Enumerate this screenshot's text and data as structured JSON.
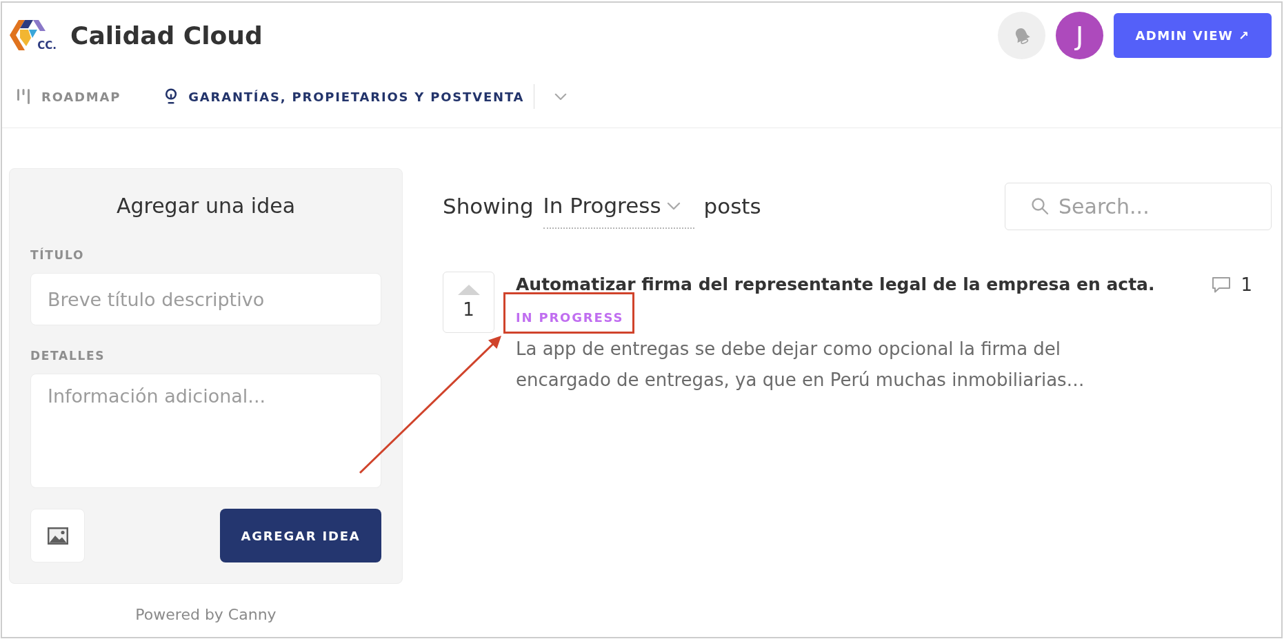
{
  "header": {
    "logo_text": "CC.",
    "title": "Calidad Cloud",
    "avatar_letter": "J",
    "admin_button": "ADMIN VIEW ↗"
  },
  "nav": [
    {
      "kind": "roadmap",
      "label": "ROADMAP",
      "selected": false
    },
    {
      "kind": "board",
      "label": "GARANTÍAS, PROPIETARIOS Y POSTVENTA",
      "selected": true
    }
  ],
  "idea_form": {
    "heading": "Agregar una idea",
    "fields": [
      {
        "kind": "input",
        "label": "TÍTULO",
        "placeholder": "Breve título descriptivo"
      },
      {
        "kind": "textarea",
        "label": "DETALLES",
        "placeholder": "Información adicional..."
      }
    ],
    "submit_button": "AGREGAR IDEA"
  },
  "powered_by": "Powered by Canny",
  "filter": {
    "prefix": "Showing",
    "value": "In Progress",
    "suffix": "posts"
  },
  "search": {
    "placeholder": "Search..."
  },
  "posts": [
    {
      "votes": "1",
      "title": "Automatizar firma del representante legal de la empresa en acta.",
      "status": {
        "label": "IN PROGRESS",
        "color": "#c06ef0",
        "highlighted": true
      },
      "description": "La app de entregas se debe dejar como opcional la firma del encargado de entregas, ya que en Perú muchas inmobiliarias…",
      "comments": "1"
    }
  ]
}
